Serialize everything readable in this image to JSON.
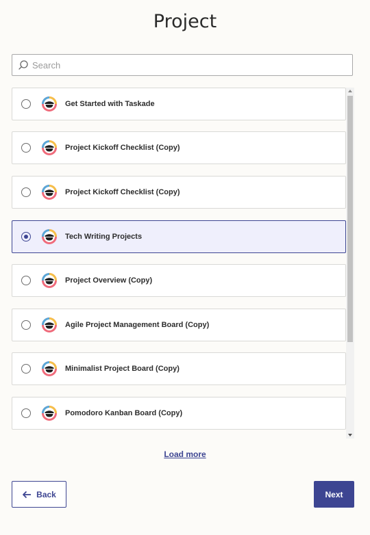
{
  "page": {
    "title": "Project"
  },
  "search": {
    "placeholder": "Search",
    "value": ""
  },
  "projects": [
    {
      "label": "Get Started with Taskade",
      "selected": false,
      "icon": "taskade-logo-icon"
    },
    {
      "label": "Project Kickoff Checklist (Copy)",
      "selected": false,
      "icon": "taskade-logo-icon"
    },
    {
      "label": "Project Kickoff Checklist (Copy)",
      "selected": false,
      "icon": "taskade-logo-icon"
    },
    {
      "label": "Tech Writing Projects",
      "selected": true,
      "icon": "taskade-logo-icon"
    },
    {
      "label": "Project Overview (Copy)",
      "selected": false,
      "icon": "taskade-logo-icon"
    },
    {
      "label": "Agile Project Management Board (Copy)",
      "selected": false,
      "icon": "taskade-logo-icon"
    },
    {
      "label": "Minimalist Project Board (Copy)",
      "selected": false,
      "icon": "taskade-logo-icon"
    },
    {
      "label": "Pomodoro Kanban Board (Copy)",
      "selected": false,
      "icon": "taskade-logo-icon"
    }
  ],
  "list": {
    "load_more_label": "Load more"
  },
  "footer": {
    "back_label": "Back",
    "next_label": "Next"
  },
  "colors": {
    "accent": "#3d4592",
    "selected_bg": "#efeffc",
    "page_bg": "#fcfbf8"
  }
}
